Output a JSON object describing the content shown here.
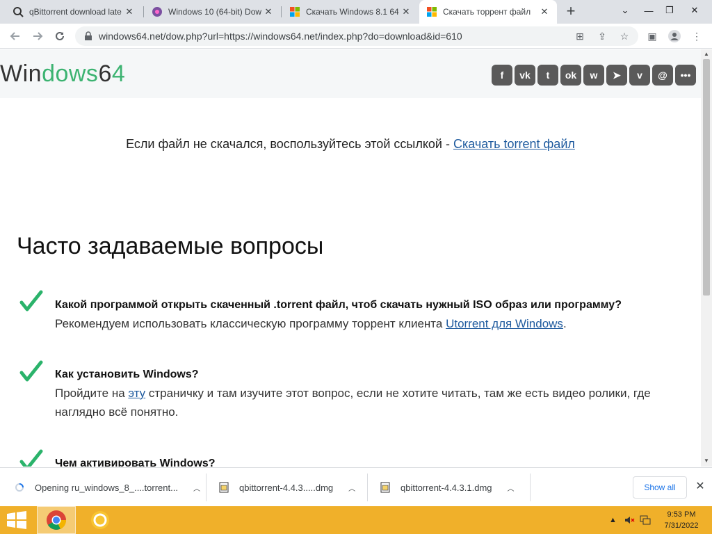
{
  "tabs": [
    {
      "title": "qBittorrent download late",
      "icon": "qbittorrent-search-icon"
    },
    {
      "title": "Windows 10 (64-bit) Dow",
      "icon": "site-icon"
    },
    {
      "title": "Скачать Windows 8.1 64",
      "icon": "windows-logo-icon"
    },
    {
      "title": "Скачать торрент файл",
      "icon": "windows-logo-icon"
    }
  ],
  "address": "windows64.net/dow.php?url=https://windows64.net/index.php?do=download&id=610",
  "logo": {
    "part1": "Win",
    "part2": "dows",
    "part3": "6",
    "part4": "4"
  },
  "social_icons": [
    "facebook-icon",
    "vk-icon",
    "twitter-icon",
    "odnoklassniki-icon",
    "whatsapp-icon",
    "telegram-icon",
    "viber-icon",
    "email-icon",
    "more-icon"
  ],
  "social_glyphs": [
    "f",
    "vk",
    "t",
    "ok",
    "w",
    "➤",
    "v",
    "@",
    "•••"
  ],
  "notice": {
    "text": "Если файл не скачался, воспользуйтесь этой ссылкой - ",
    "link": "Скачать torrent файл"
  },
  "faq": {
    "title": "Часто задаваемые вопросы",
    "items": [
      {
        "q": "Какой программой открыть скаченный .torrent файл, чтоб скачать нужный ISO образ или программу?",
        "a_pre": "Рекомендуем использовать классическую программу торрент клиента ",
        "a_link": "Utorrent для Windows",
        "a_post": "."
      },
      {
        "q": "Как установить Windows?",
        "a_pre": "Пройдите на ",
        "a_link": "эту",
        "a_post": " страничку и там изучите этот вопрос, если не хотите читать, там же есть видео ролики, где наглядно всё понятно."
      },
      {
        "q": "Чем активировать Windows?"
      }
    ]
  },
  "downloads": [
    {
      "name": "Opening ru_windows_8_....torrent...",
      "icon": "loading-icon"
    },
    {
      "name": "qbittorrent-4.4.3.....dmg",
      "icon": "file-icon"
    },
    {
      "name": "qbittorrent-4.4.3.1.dmg",
      "icon": "file-icon"
    }
  ],
  "show_all": "Show all",
  "clock": {
    "time": "9:53 PM",
    "date": "7/31/2022"
  },
  "colors": {
    "accent_green": "#3cb371",
    "taskbar": "#f0b02a",
    "link": "#1e5a9e"
  }
}
